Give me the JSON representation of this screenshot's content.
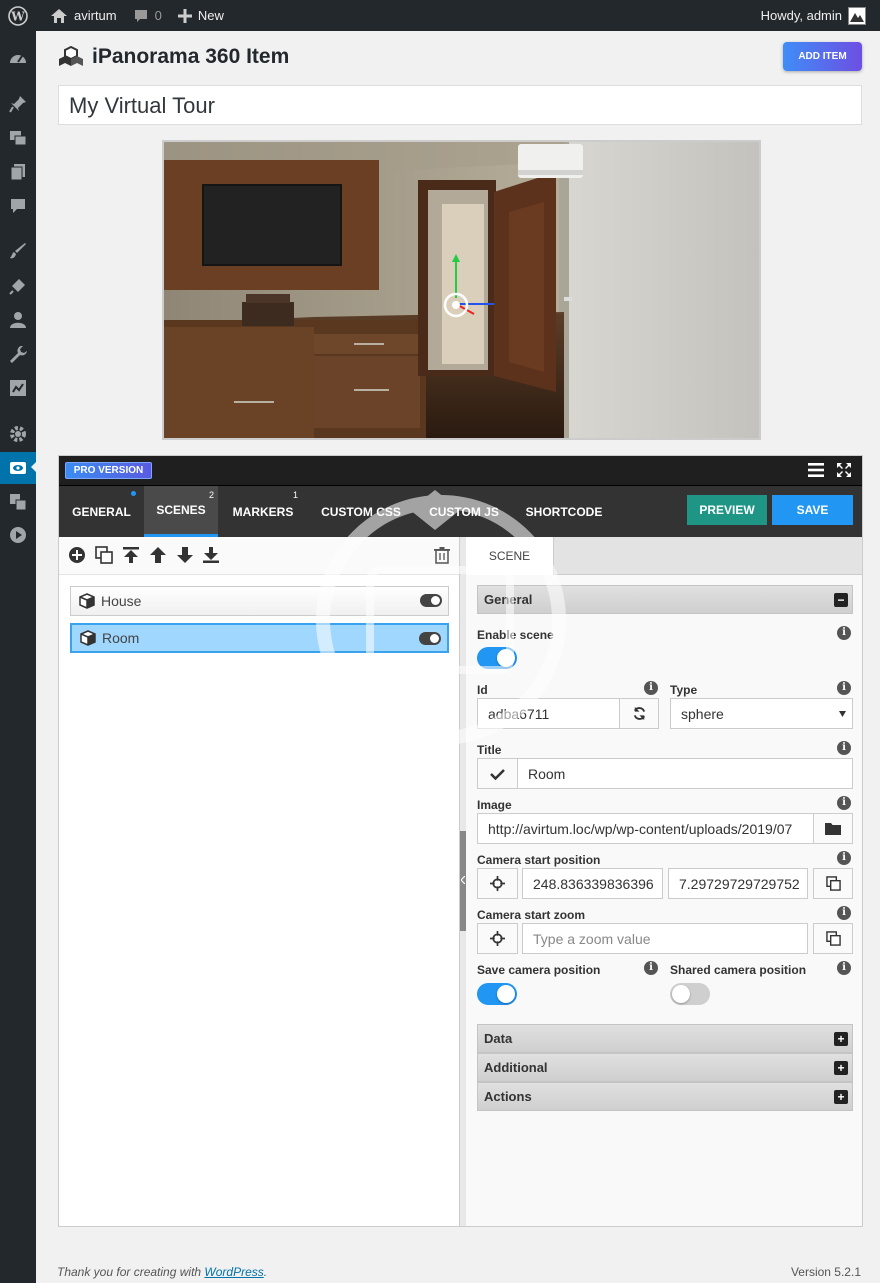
{
  "admin_bar": {
    "site_name": "avirtum",
    "comments_count": "0",
    "new_label": "New",
    "howdy": "Howdy, admin"
  },
  "page": {
    "title": "iPanorama 360 Item",
    "add_item_label": "ADD ITEM",
    "item_title": "My Virtual Tour"
  },
  "editor": {
    "pro_badge": "PRO VERSION",
    "tabs": [
      {
        "label": "GENERAL",
        "badge": ""
      },
      {
        "label": "SCENES",
        "badge": "2"
      },
      {
        "label": "MARKERS",
        "badge": "1"
      },
      {
        "label": "CUSTOM CSS",
        "badge": ""
      },
      {
        "label": "CUSTOM JS",
        "badge": ""
      },
      {
        "label": "SHORTCODE",
        "badge": ""
      }
    ],
    "preview_label": "PREVIEW",
    "save_label": "SAVE",
    "scenes": [
      {
        "name": "House",
        "selected": false
      },
      {
        "name": "Room",
        "selected": true
      }
    ],
    "scene_panel": {
      "tab_label": "SCENE",
      "general_header": "General",
      "enable_scene_label": "Enable scene",
      "id_label": "Id",
      "id_value": "adba6711",
      "type_label": "Type",
      "type_value": "sphere",
      "title_label": "Title",
      "title_value": "Room",
      "image_label": "Image",
      "image_value": "http://avirtum.loc/wp/wp-content/uploads/2019/07",
      "camera_start_position_label": "Camera start position",
      "camera_x": "248.836339836396",
      "camera_y": "7.29729729729752",
      "camera_start_zoom_label": "Camera start zoom",
      "zoom_placeholder": "Type a zoom value",
      "save_camera_label": "Save camera position",
      "shared_camera_label": "Shared camera position",
      "sections": [
        "Data",
        "Additional",
        "Actions"
      ]
    }
  },
  "footer": {
    "thanks_prefix": "Thank you for creating with ",
    "wordpress_link": "WordPress",
    "thanks_suffix": ".",
    "version": "Version 5.2.1"
  },
  "colors": {
    "admin_bar": "#23282d",
    "accent_blue": "#2196f3",
    "preview_button": "#1e9585",
    "wp_active": "#0073aa"
  }
}
